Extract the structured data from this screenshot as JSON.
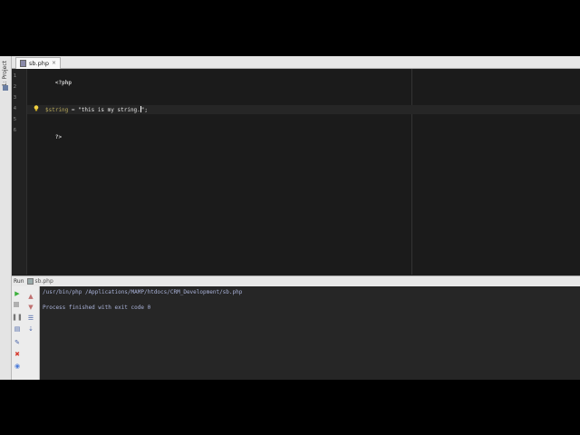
{
  "project_tool": {
    "label": "1: Project"
  },
  "tabs": [
    {
      "label": "sb.php"
    }
  ],
  "editor": {
    "line_numbers": [
      "1",
      "2",
      "3",
      "4",
      "5",
      "6"
    ],
    "lines": {
      "l1": "<?php",
      "l4_var": "$string",
      "l4_op": " = ",
      "l4_str_before_caret": "\"this is my string.",
      "l4_str_after_caret": "\";",
      "l6": "?>"
    }
  },
  "run_bar": {
    "title": "Run",
    "tab_label": "sb.php"
  },
  "console": {
    "lines": [
      "/usr/bin/php /Applications/MAMP/htdocs/CRM_Development/sb.php",
      "",
      "Process finished with exit code 0"
    ]
  },
  "colors": {
    "editor_bg": "#1b1b1b",
    "console_bg": "#262626",
    "console_text": "#a9b2d8",
    "run_green": "#3bb03b",
    "stop_red": "#d63b2f"
  }
}
